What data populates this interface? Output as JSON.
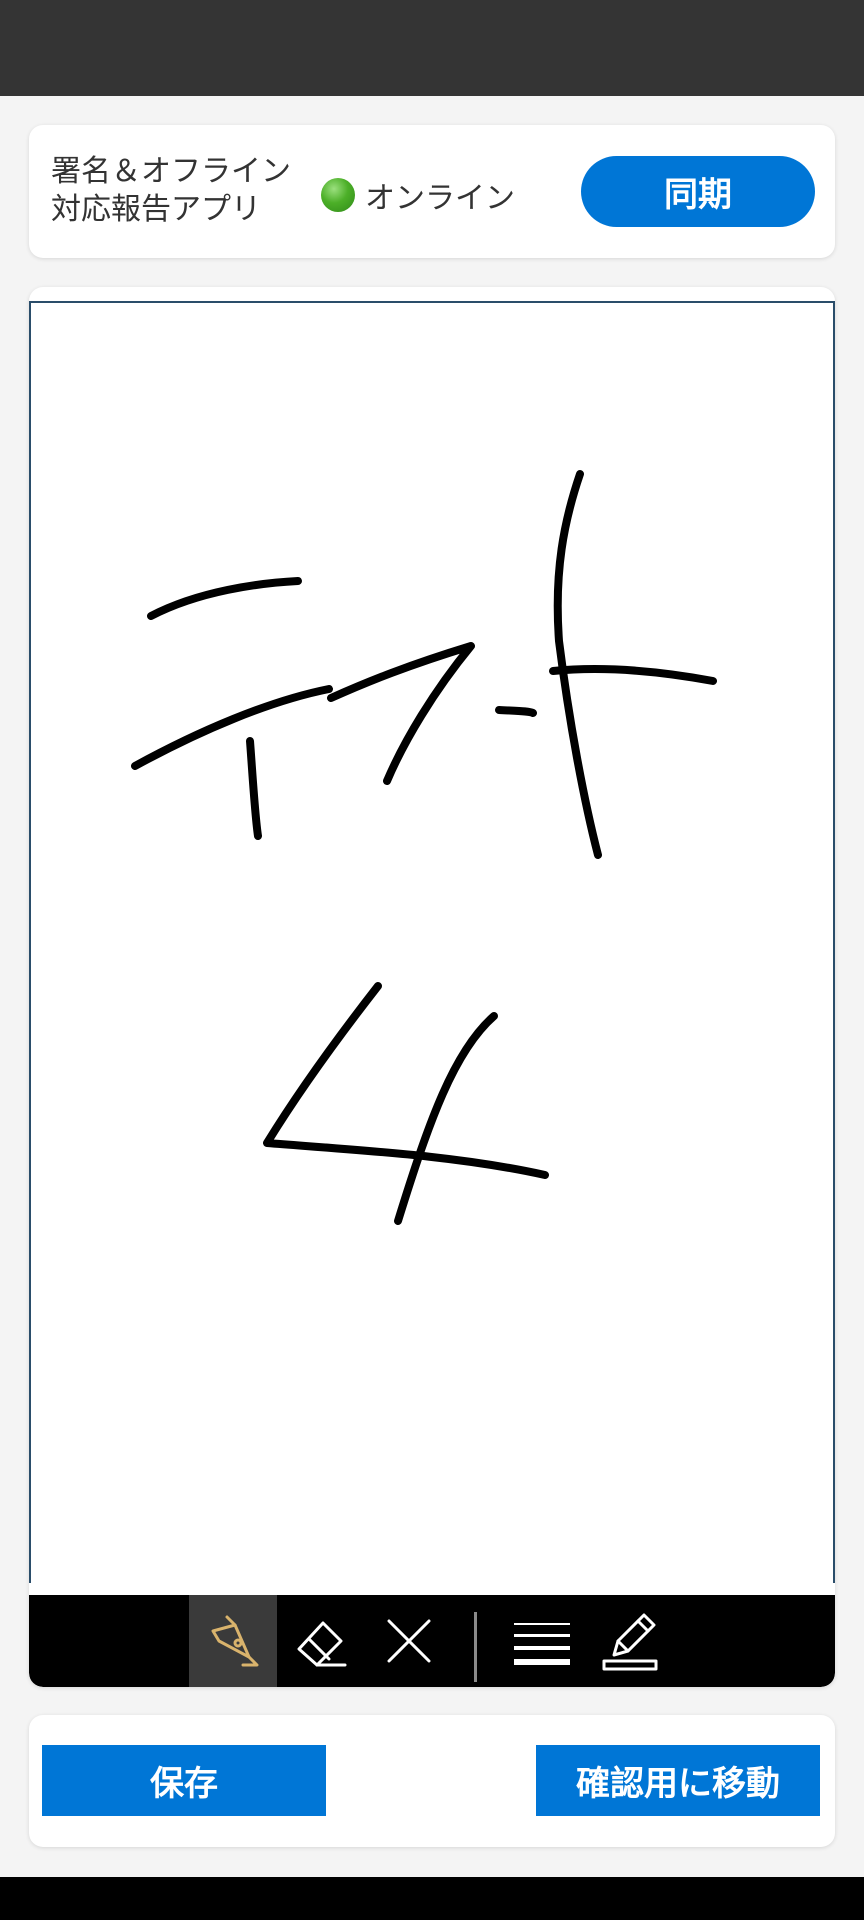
{
  "header": {
    "app_title_line1": "署名＆オフライン",
    "app_title_line2": "対応報告アプリ",
    "connection_status": "オンライン",
    "sync_label": "同期"
  },
  "toolbar": {
    "tools": [
      "pen-icon",
      "eraser-icon",
      "clear-icon",
      "line-width-icon",
      "edit-icon"
    ],
    "active_tool": "pen-icon",
    "active_color": "#d9b36c"
  },
  "footer": {
    "save_label": "保存",
    "confirm_label": "確認用に移動"
  },
  "colors": {
    "accent": "#0076d6",
    "status_online": "#4caf28"
  }
}
